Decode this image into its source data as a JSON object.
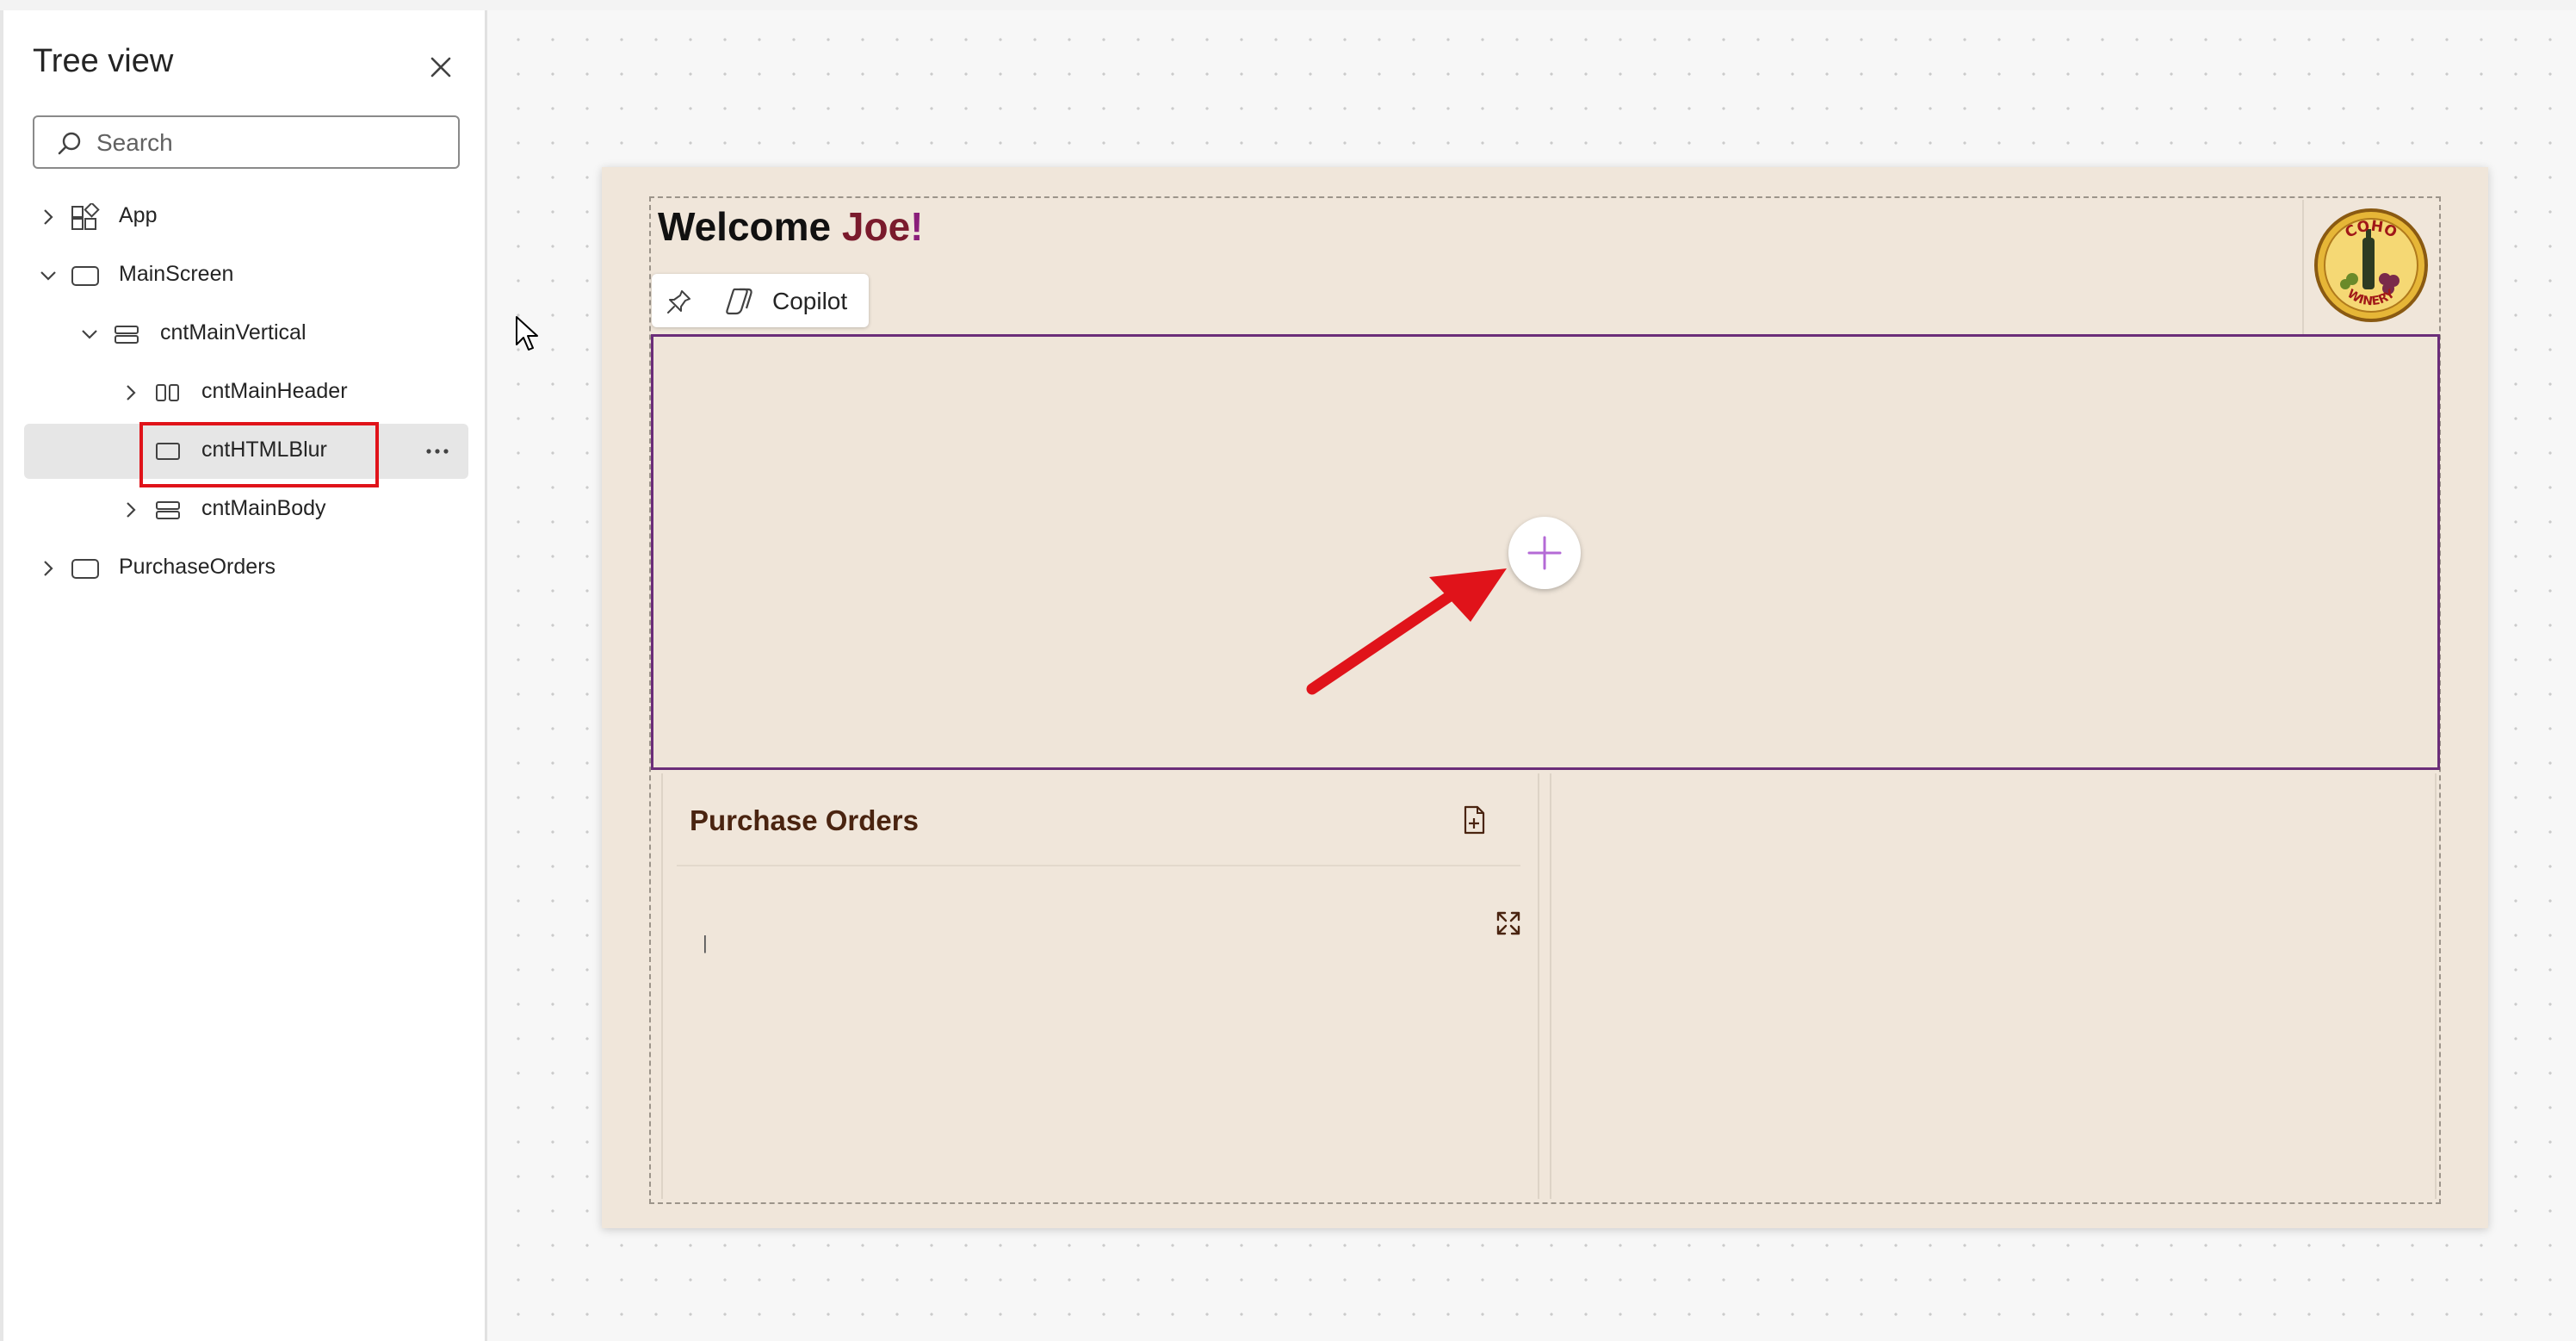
{
  "tree_view": {
    "title": "Tree view",
    "search_placeholder": "Search",
    "items": [
      {
        "label": "App",
        "icon": "app-icon",
        "expanded": false
      },
      {
        "label": "MainScreen",
        "icon": "screen-icon",
        "expanded": true
      },
      {
        "label": "cntMainVertical",
        "icon": "vertical-container-icon",
        "expanded": true
      },
      {
        "label": "cntMainHeader",
        "icon": "horizontal-container-icon",
        "expanded": false
      },
      {
        "label": "cntHTMLBlur",
        "icon": "container-icon",
        "selected": true
      },
      {
        "label": "cntMainBody",
        "icon": "vertical-container-icon",
        "expanded": false
      },
      {
        "label": "PurchaseOrders",
        "icon": "screen-icon",
        "expanded": false
      }
    ],
    "more_label": "···"
  },
  "app": {
    "welcome_prefix": "Welcome ",
    "user_name": "Joe",
    "welcome_suffix": "!",
    "logo_text_top": "COHO",
    "logo_text_bottom": "WINERY",
    "copilot_label": "Copilot",
    "purchase_orders_title": "Purchase Orders",
    "text_cursor": "|"
  },
  "colors": {
    "screen_bg": "#f0e6da",
    "selection_outline": "#6b2d79",
    "highlight_red": "#e0131a",
    "title_brown": "#4a2410",
    "user_name": "#7a1a2c"
  }
}
